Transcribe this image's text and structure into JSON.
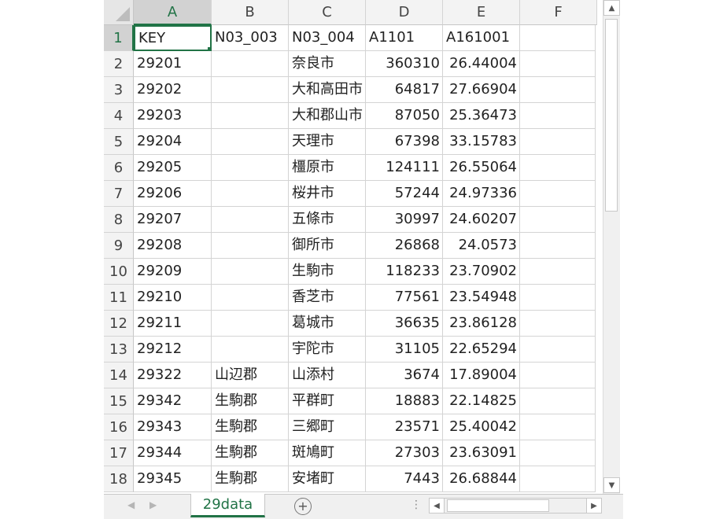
{
  "columns": [
    "A",
    "B",
    "C",
    "D",
    "E",
    "F"
  ],
  "selected_column": "A",
  "selected_row": "1",
  "rows": [
    {
      "n": "1",
      "a": "KEY",
      "b": "N03_003",
      "c": "N03_004",
      "d": "A1101",
      "e": "A161001"
    },
    {
      "n": "2",
      "a": "29201",
      "b": "",
      "c": "奈良市",
      "d": "360310",
      "e": "26.44004"
    },
    {
      "n": "3",
      "a": "29202",
      "b": "",
      "c": "大和高田市",
      "d": "64817",
      "e": "27.66904"
    },
    {
      "n": "4",
      "a": "29203",
      "b": "",
      "c": "大和郡山市",
      "d": "87050",
      "e": "25.36473"
    },
    {
      "n": "5",
      "a": "29204",
      "b": "",
      "c": "天理市",
      "d": "67398",
      "e": "33.15783"
    },
    {
      "n": "6",
      "a": "29205",
      "b": "",
      "c": "橿原市",
      "d": "124111",
      "e": "26.55064"
    },
    {
      "n": "7",
      "a": "29206",
      "b": "",
      "c": "桜井市",
      "d": "57244",
      "e": "24.97336"
    },
    {
      "n": "8",
      "a": "29207",
      "b": "",
      "c": "五條市",
      "d": "30997",
      "e": "24.60207"
    },
    {
      "n": "9",
      "a": "29208",
      "b": "",
      "c": "御所市",
      "d": "26868",
      "e": "24.0573"
    },
    {
      "n": "10",
      "a": "29209",
      "b": "",
      "c": "生駒市",
      "d": "118233",
      "e": "23.70902"
    },
    {
      "n": "11",
      "a": "29210",
      "b": "",
      "c": "香芝市",
      "d": "77561",
      "e": "23.54948"
    },
    {
      "n": "12",
      "a": "29211",
      "b": "",
      "c": "葛城市",
      "d": "36635",
      "e": "23.86128"
    },
    {
      "n": "13",
      "a": "29212",
      "b": "",
      "c": "宇陀市",
      "d": "31105",
      "e": "22.65294"
    },
    {
      "n": "14",
      "a": "29322",
      "b": "山辺郡",
      "c": "山添村",
      "d": "3674",
      "e": "17.89004"
    },
    {
      "n": "15",
      "a": "29342",
      "b": "生駒郡",
      "c": "平群町",
      "d": "18883",
      "e": "22.14825"
    },
    {
      "n": "16",
      "a": "29343",
      "b": "生駒郡",
      "c": "三郷町",
      "d": "23571",
      "e": "25.40042"
    },
    {
      "n": "17",
      "a": "29344",
      "b": "生駒郡",
      "c": "斑鳩町",
      "d": "27303",
      "e": "23.63091"
    },
    {
      "n": "18",
      "a": "29345",
      "b": "生駒郡",
      "c": "安堵町",
      "d": "7443",
      "e": "26.68844"
    }
  ],
  "sheet_tab": "29data",
  "icons": {
    "add_sheet": "plus-circle-icon",
    "scroll_up": "triangle-up-icon",
    "scroll_down": "triangle-down-icon",
    "scroll_left": "triangle-left-icon",
    "scroll_right": "triangle-right-icon",
    "sheet_prev": "chevron-left-icon",
    "sheet_next": "chevron-right-icon",
    "more": "vertical-dots-icon"
  },
  "colors": {
    "accent": "#217346",
    "header_bg": "#f3f3f3",
    "selected_header_bg": "#d2d2d2",
    "gridline": "#d4d4d4"
  }
}
